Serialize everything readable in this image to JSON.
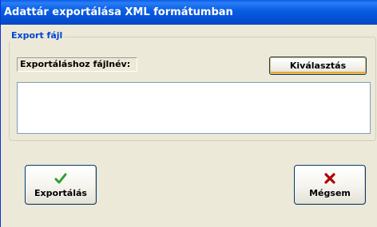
{
  "window": {
    "title": "Adattár exportálása XML formátumban"
  },
  "export_group": {
    "legend": "Export fájl",
    "filename_label": "Exportáláshoz fájlnév:",
    "select_button": "Kiválasztás",
    "filename_value": ""
  },
  "buttons": {
    "export_label": "Exportálás",
    "export_icon": "checkmark-icon",
    "cancel_label": "Mégsem",
    "cancel_icon": "x-icon"
  },
  "colors": {
    "titlebar": "#0a5fe6",
    "legend_text": "#0046d5",
    "check_green": "#2e9e2e",
    "cancel_red": "#b00000"
  }
}
